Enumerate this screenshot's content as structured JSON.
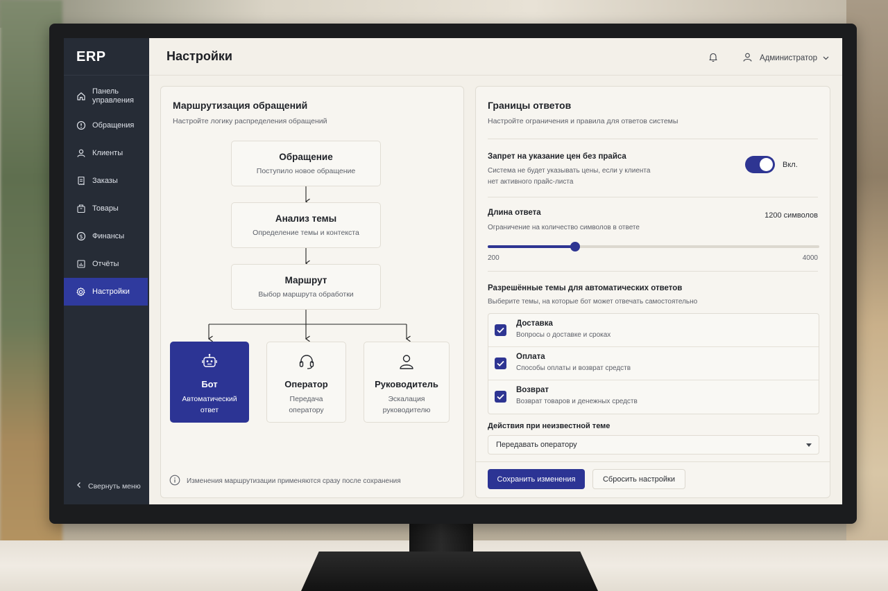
{
  "app": {
    "logo": "ERP",
    "page_title": "Настройки",
    "user_name": "Администратор"
  },
  "sidebar": {
    "items": [
      {
        "label": "Панель управления",
        "icon": "home-icon"
      },
      {
        "label": "Обращения",
        "icon": "alert-circle-icon"
      },
      {
        "label": "Клиенты",
        "icon": "user-icon"
      },
      {
        "label": "Заказы",
        "icon": "receipt-icon"
      },
      {
        "label": "Товары",
        "icon": "box-icon"
      },
      {
        "label": "Финансы",
        "icon": "dollar-icon"
      },
      {
        "label": "Отчёты",
        "icon": "chart-icon"
      },
      {
        "label": "Настройки",
        "icon": "gear-icon",
        "active": true
      }
    ],
    "collapse_label": "Свернуть меню"
  },
  "routing": {
    "title": "Маршрутизация обращений",
    "subtitle": "Настройте логику распределения обращений",
    "steps": [
      {
        "title": "Обращение",
        "subtitle": "Поступило новое обращение"
      },
      {
        "title": "Анализ темы",
        "subtitle": "Определение темы и контекста"
      },
      {
        "title": "Маршрут",
        "subtitle": "Выбор маршрута обработки"
      }
    ],
    "targets": [
      {
        "title": "Бот",
        "subtitle": "Автоматический ответ",
        "icon": "robot-icon",
        "selected": true
      },
      {
        "title": "Оператор",
        "subtitle": "Передача оператору",
        "icon": "headset-icon"
      },
      {
        "title": "Руководитель",
        "subtitle": "Эскалация руководителю",
        "icon": "person-icon"
      }
    ],
    "note": "Изменения маршрутизации применяются сразу после сохранения"
  },
  "limits": {
    "title": "Границы ответов",
    "subtitle": "Настройте ограничения и правила для ответов системы",
    "price_rule": {
      "label": "Запрет на указание цен без прайса",
      "desc1": "Система не будет указывать цены, если у клиента",
      "desc2": "нет активного прайс-листа",
      "state_label": "Вкл.",
      "enabled": true
    },
    "length": {
      "label": "Длина ответа",
      "desc": "Ограничение на количество символов в ответе",
      "value_label": "1200 символов",
      "value": 1200,
      "min": 200,
      "max": 4000,
      "min_label": "200",
      "max_label": "4000"
    },
    "topics_label": "Разрешённые темы для автоматических ответов",
    "topics_desc": "Выберите темы, на которые бот может отвечать самостоятельно",
    "topics": [
      {
        "title": "Доставка",
        "desc": "Вопросы о доставке и сроках",
        "checked": true
      },
      {
        "title": "Оплата",
        "desc": "Способы оплаты и возврат средств",
        "checked": true
      },
      {
        "title": "Возврат",
        "desc": "Возврат товаров и денежных средств",
        "checked": true
      }
    ],
    "unknown_label": "Действия при неизвестной теме",
    "unknown_value": "Передавать оператору",
    "save_label": "Сохранить изменения",
    "reset_label": "Сбросить настройки"
  },
  "colors": {
    "accent": "#2c3494",
    "sidebar": "#262c36",
    "surface": "#f3f0e9"
  }
}
